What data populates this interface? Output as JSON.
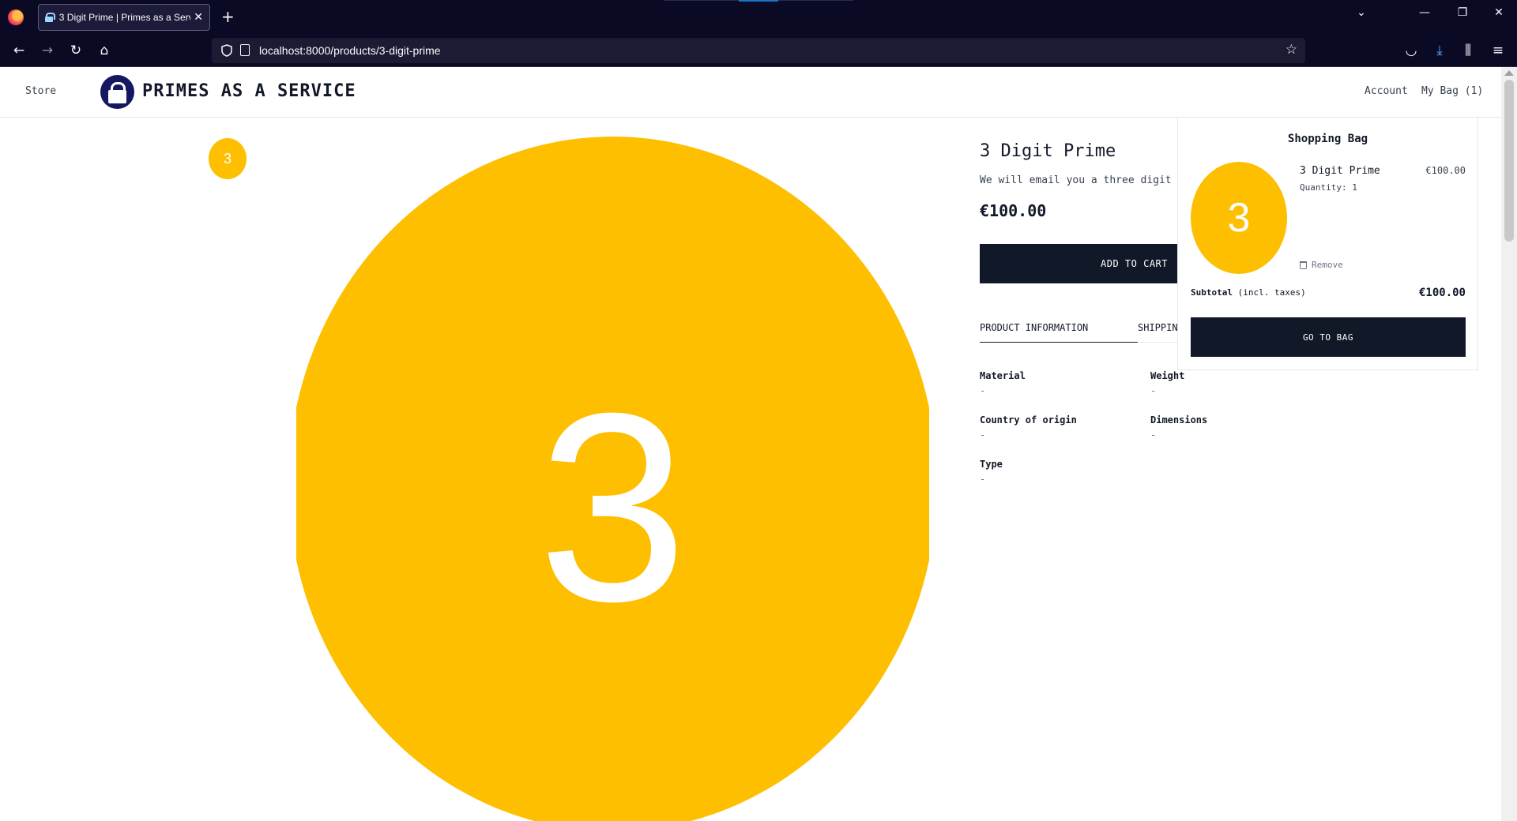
{
  "browser": {
    "tab_title": "3 Digit Prime | Primes as a Service",
    "tab_close": "✕",
    "new_tab": "+",
    "url": "localhost:8000/products/3-digit-prime"
  },
  "header": {
    "store_label": "Store",
    "brand_name": "PRIMES AS A SERVICE",
    "account_label": "Account",
    "bag_label": "My Bag (1)"
  },
  "gallery": {
    "thumb_digit": "3",
    "hero_digit": "3"
  },
  "product": {
    "title": "3 Digit Prime",
    "description": "We will email you a three digit prime number.",
    "price": "€100.00",
    "add_to_cart": "ADD TO CART",
    "tabs": [
      "PRODUCT INFORMATION",
      "SHIPPING & RETURNS"
    ],
    "specs": [
      {
        "label": "Material",
        "value": "-"
      },
      {
        "label": "Weight",
        "value": "-"
      },
      {
        "label": "Country of origin",
        "value": "-"
      },
      {
        "label": "Dimensions",
        "value": "-"
      },
      {
        "label": "Type",
        "value": "-"
      }
    ]
  },
  "bag": {
    "title": "Shopping Bag",
    "item": {
      "digit": "3",
      "name": "3 Digit Prime",
      "quantity": "Quantity: 1",
      "price": "€100.00",
      "remove": "Remove"
    },
    "subtotal_label": "Subtotal",
    "subtotal_note": "(incl. taxes)",
    "subtotal_value": "€100.00",
    "go_to_bag": "GO TO BAG"
  },
  "colors": {
    "accent_yellow": "#fdbf00",
    "dark_button": "#111827",
    "browser_chrome": "#0b0a25"
  }
}
